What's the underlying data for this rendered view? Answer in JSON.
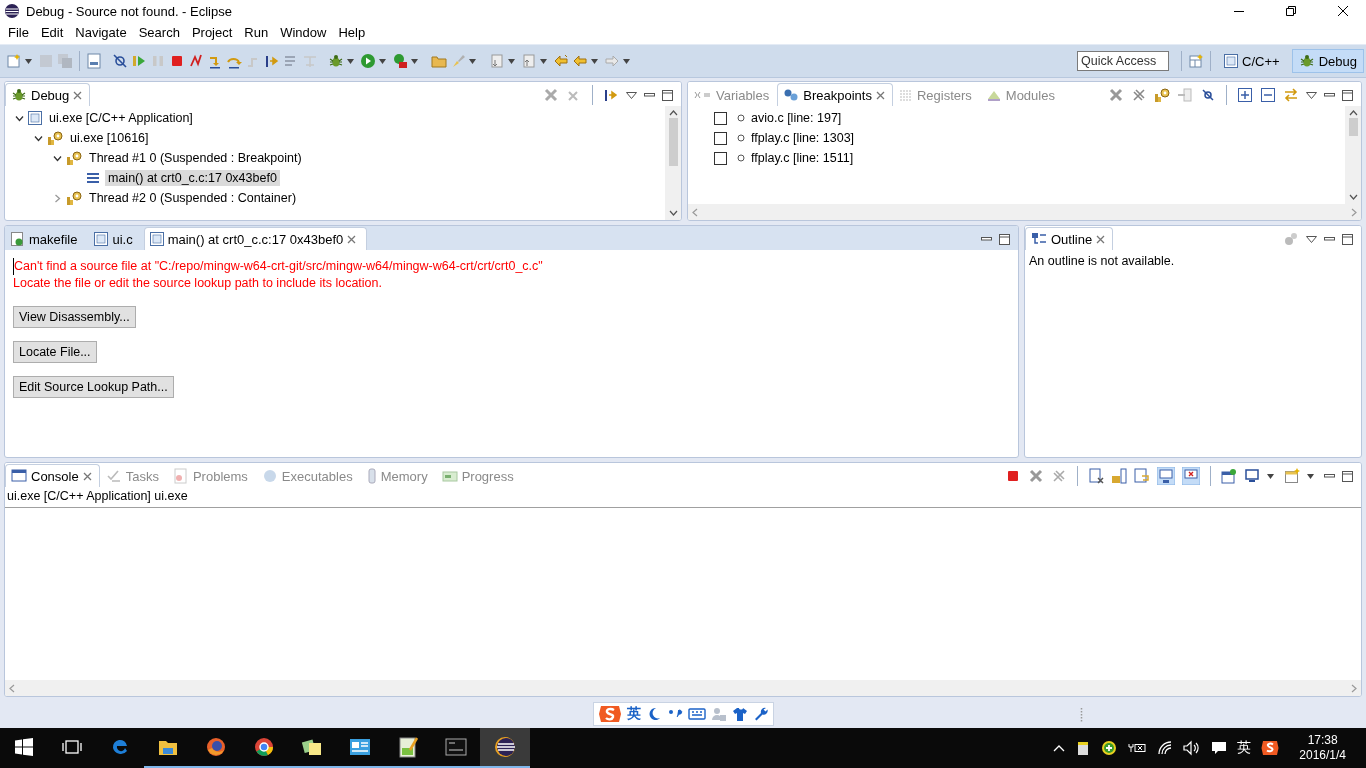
{
  "window": {
    "title": "Debug - Source not found. - Eclipse"
  },
  "menu": [
    "File",
    "Edit",
    "Navigate",
    "Search",
    "Project",
    "Run",
    "Window",
    "Help"
  ],
  "toolbar": {
    "quick_access": {
      "placeholder": "Quick Access"
    },
    "perspectives": [
      {
        "label": "C/C++",
        "selected": false
      },
      {
        "label": "Debug",
        "selected": true
      }
    ]
  },
  "debug_view": {
    "tab": "Debug",
    "tree": [
      {
        "kind": "launch",
        "label": "ui.exe [C/C++ Application]",
        "expanded": true,
        "selected": false,
        "children": [
          {
            "kind": "process",
            "label": "ui.exe [10616]",
            "expanded": true,
            "selected": false,
            "children": [
              {
                "kind": "thread",
                "label": "Thread #1 0 (Suspended : Breakpoint)",
                "expanded": true,
                "selected": false,
                "children": [
                  {
                    "kind": "frame",
                    "label": "main() at crt0_c.c:17 0x43bef0",
                    "selected": true
                  }
                ]
              },
              {
                "kind": "thread",
                "label": "Thread #2 0 (Suspended : Container)",
                "expanded": false,
                "selected": false
              }
            ]
          }
        ]
      }
    ]
  },
  "breakpoints_view": {
    "tabs": [
      {
        "label": "Variables",
        "selected": false
      },
      {
        "label": "Breakpoints",
        "selected": true
      },
      {
        "label": "Registers",
        "selected": false
      },
      {
        "label": "Modules",
        "selected": false
      }
    ],
    "breakpoints": [
      {
        "label": "avio.c [line: 197]",
        "checked": false
      },
      {
        "label": "ffplay.c [line: 1303]",
        "checked": false
      },
      {
        "label": "ffplay.c [line: 1511]",
        "checked": false
      }
    ]
  },
  "editor": {
    "tabs": [
      {
        "kind": "makefile",
        "label": "makefile",
        "selected": false
      },
      {
        "kind": "c",
        "label": "ui.c",
        "selected": false
      },
      {
        "kind": "c",
        "label": "main() at crt0_c.c:17 0x43bef0",
        "selected": true
      }
    ],
    "error_lines": [
      "Can't find a source file at \"C:/repo/mingw-w64-crt-git/src/mingw-w64/mingw-w64-crt/crt/crt0_c.c\"",
      "Locate the file or edit the source lookup path to include its location."
    ],
    "buttons": [
      "View Disassembly...",
      "Locate File...",
      "Edit Source Lookup Path..."
    ]
  },
  "outline": {
    "tab": "Outline",
    "message": "An outline is not available."
  },
  "console": {
    "tabs": [
      {
        "label": "Console",
        "selected": true
      },
      {
        "label": "Tasks",
        "selected": false
      },
      {
        "label": "Problems",
        "selected": false
      },
      {
        "label": "Executables",
        "selected": false
      },
      {
        "label": "Memory",
        "selected": false
      },
      {
        "label": "Progress",
        "selected": false
      }
    ],
    "process": "ui.exe [C/C++ Application] ui.exe"
  },
  "ime": {
    "mode": "英"
  },
  "taskbar": {
    "tray_ime": "英",
    "time": "17:38",
    "date": "2016/1/4"
  }
}
